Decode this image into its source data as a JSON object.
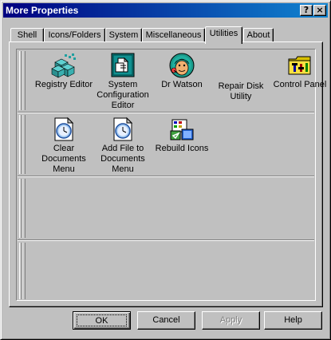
{
  "window": {
    "title": "More Properties",
    "help_glyph": "?",
    "close_glyph": "×"
  },
  "tabs": [
    {
      "label": "Shell"
    },
    {
      "label": "Icons/Folders"
    },
    {
      "label": "System"
    },
    {
      "label": "Miscellaneous"
    },
    {
      "label": "Utilities",
      "active": true
    },
    {
      "label": "About"
    }
  ],
  "tools_row1": [
    {
      "icon": "registry-editor-icon",
      "label": "Registry Editor"
    },
    {
      "icon": "system-configuration-editor-icon",
      "label": "System Configuration Editor"
    },
    {
      "icon": "dr-watson-icon",
      "label": "Dr Watson"
    },
    {
      "icon": "repair-disk-utility-icon",
      "label": "Repair Disk Utility"
    },
    {
      "icon": "control-panel-icon",
      "label": "Control Panel"
    }
  ],
  "tools_row2": [
    {
      "icon": "clear-documents-menu-icon",
      "label": "Clear Documents Menu"
    },
    {
      "icon": "add-file-to-documents-menu-icon",
      "label": "Add File to Documents Menu"
    },
    {
      "icon": "rebuild-icons-icon",
      "label": "Rebuild Icons"
    }
  ],
  "buttons": {
    "ok": "OK",
    "cancel": "Cancel",
    "apply": "Apply",
    "help": "Help"
  }
}
